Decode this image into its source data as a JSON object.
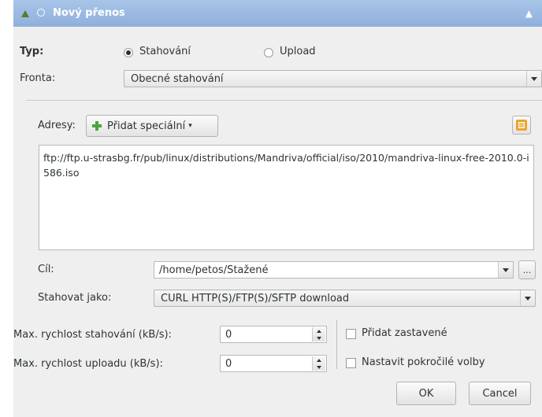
{
  "window": {
    "title": "Nový přenos"
  },
  "type": {
    "label": "Typ:",
    "options": [
      "Stahování",
      "Upload"
    ],
    "selected": "Stahování"
  },
  "queue": {
    "label": "Fronta:",
    "value": "Obecné stahování"
  },
  "addresses": {
    "label": "Adresy:",
    "add_special_label": "Přidat speciální",
    "text": "ftp://ftp.u-strasbg.fr/pub/linux/distributions/Mandriva/official/iso/2010/mandriva-linux-free-2010.0-i586.iso"
  },
  "target": {
    "label": "Cíl:",
    "value": "/home/petos/Stažené",
    "browse_label": "..."
  },
  "download_as": {
    "label": "Stahovat jako:",
    "value": "CURL HTTP(S)/FTP(S)/SFTP download"
  },
  "speed": {
    "download_label": "Max. rychlost stahování (kB/s):",
    "download_value": "0",
    "upload_label": "Max. rychlost uploadu (kB/s):",
    "upload_value": "0"
  },
  "options": {
    "add_paused": "Přidat zastavené",
    "advanced": "Nastavit pokročilé volby"
  },
  "buttons": {
    "ok": "OK",
    "cancel": "Cancel"
  },
  "colors": {
    "titlebar": "#8fb0dc",
    "dialog_bg": "#efefef",
    "plus_green": "#4aa63a",
    "orange_icon": "#f0a22e"
  }
}
